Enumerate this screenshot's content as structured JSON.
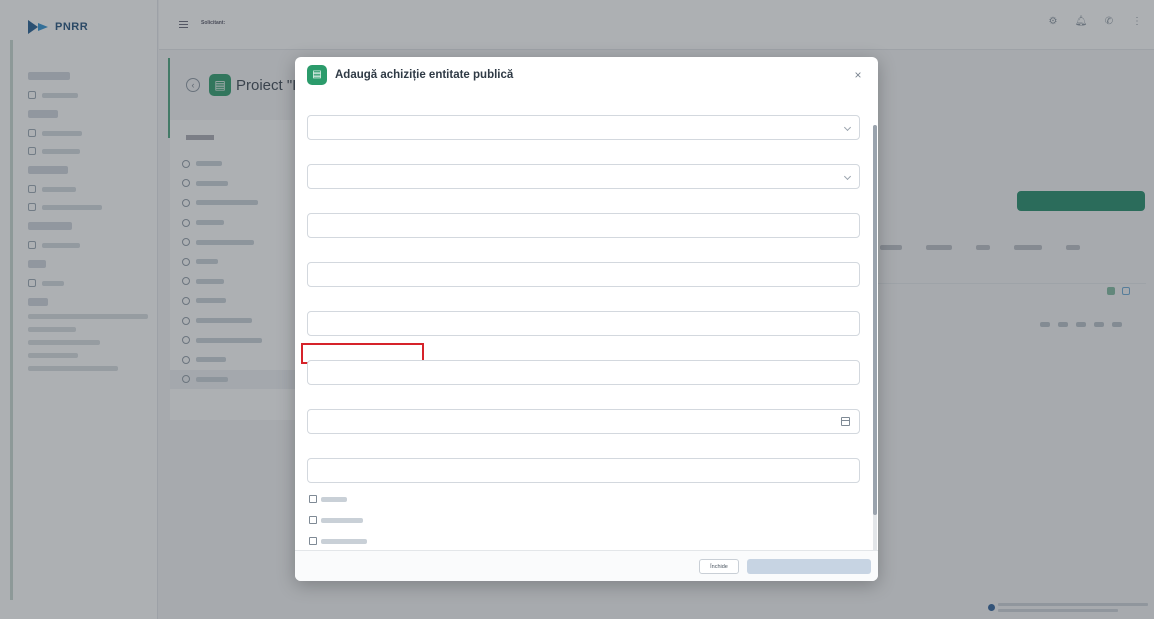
{
  "app": {
    "logo_text": "PNRR"
  },
  "topbar": {
    "user_label": "Solicitant:",
    "user_value": "",
    "user_sub": "",
    "icons": [
      "settings-icon",
      "bell-icon",
      "notification-icon",
      "menu-dots-icon"
    ]
  },
  "page": {
    "title": "Proiect \"In",
    "back_icon": "back-icon"
  },
  "modal": {
    "title": "Adaugă achiziție entitate publică",
    "close": "×",
    "footer": {
      "cancel": "Închide",
      "submit": ""
    }
  },
  "accent_colors": {
    "primary": "#2b9b6b",
    "highlight_box": "#d6232a",
    "overlay": "rgba(60,66,74,0.42)"
  }
}
